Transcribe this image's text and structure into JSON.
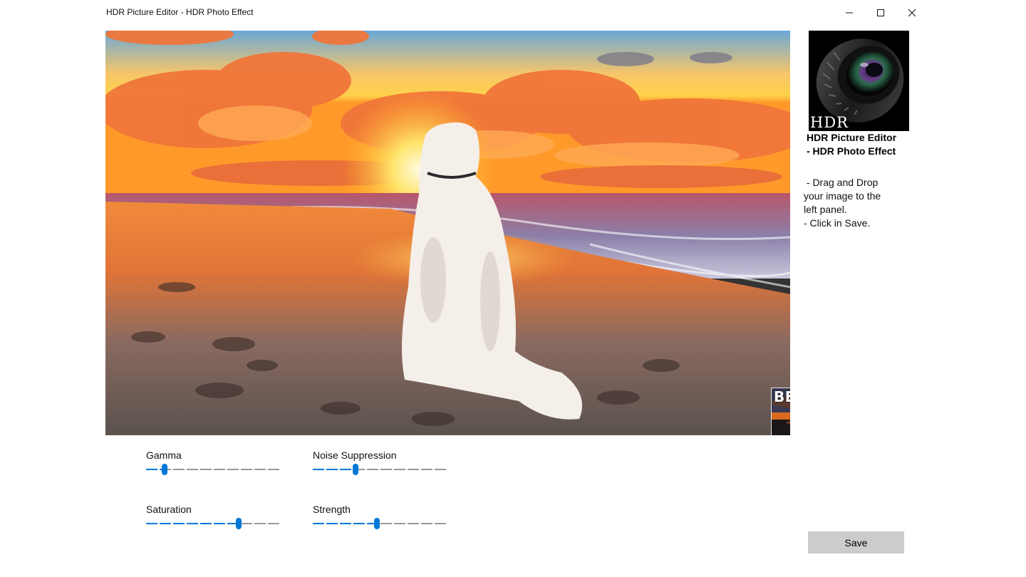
{
  "window": {
    "title": "HDR Picture Editor - HDR Photo Effect",
    "controls": [
      "minimize-icon",
      "maximize-icon",
      "close-icon"
    ]
  },
  "preview": {
    "before_label": "BEFORE"
  },
  "side_panel": {
    "logo_text": "HDR",
    "app_name_line1": "HDR Picture Editor",
    "app_name_line2": "- HDR Photo Effect",
    "instructions": [
      " - Drag and Drop",
      "your image to the",
      "left panel.",
      "- Click in Save."
    ],
    "save_label": "Save"
  },
  "sliders": [
    {
      "label": "Gamma",
      "value": 0.12,
      "accent": "#0078d7"
    },
    {
      "label": "Noise Suppression",
      "value": 0.31,
      "accent": "#0078d7"
    },
    {
      "label": "Saturation",
      "value": 0.7,
      "accent": "#0078d7"
    },
    {
      "label": "Strength",
      "value": 0.48,
      "accent": "#0078d7"
    }
  ],
  "colors": {
    "accent": "#0078d7",
    "track": "#999999",
    "save_bg": "#cccccc"
  }
}
